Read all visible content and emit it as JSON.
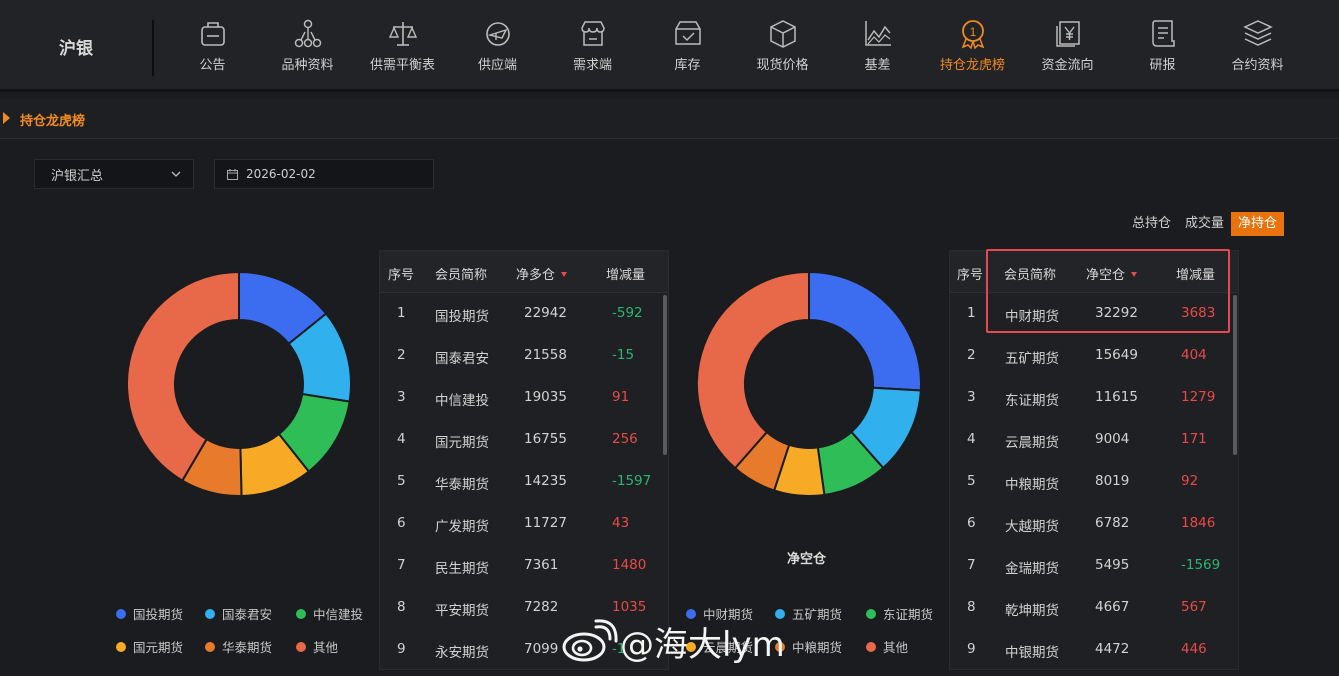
{
  "brand": "沪银",
  "nav": [
    {
      "label": "公告",
      "icon": "announcement-icon",
      "active": false
    },
    {
      "label": "品种资料",
      "icon": "network-icon",
      "active": false
    },
    {
      "label": "供需平衡表",
      "icon": "balance-scale-icon",
      "active": false
    },
    {
      "label": "供应端",
      "icon": "supply-plane-icon",
      "active": false
    },
    {
      "label": "需求端",
      "icon": "store-icon",
      "active": false
    },
    {
      "label": "库存",
      "icon": "inventory-box-icon",
      "active": false
    },
    {
      "label": "现货价格",
      "icon": "cube-icon",
      "active": false
    },
    {
      "label": "基差",
      "icon": "line-chart-icon",
      "active": false
    },
    {
      "label": "持仓龙虎榜",
      "icon": "medal-icon",
      "active": true
    },
    {
      "label": "资金流向",
      "icon": "yen-icon",
      "active": false
    },
    {
      "label": "研报",
      "icon": "report-icon",
      "active": false
    },
    {
      "label": "合约资料",
      "icon": "layers-icon",
      "active": false
    }
  ],
  "section_title": "持仓龙虎榜",
  "filters": {
    "contract": "沪银汇总",
    "date": "2026-02-02"
  },
  "toggle": [
    {
      "label": "总持仓",
      "active": false
    },
    {
      "label": "成交量",
      "active": false
    },
    {
      "label": "净持仓",
      "active": true
    }
  ],
  "colors": {
    "accent": "#f08b21",
    "positive": "#e84a4a",
    "negative": "#2bb573",
    "highlight": "#e8484f"
  },
  "long_table": {
    "headers": [
      "序号",
      "会员简称",
      "净多仓",
      "增减量"
    ],
    "rows": [
      {
        "rank": "1",
        "member": "国投期货",
        "value": "22942",
        "change": "-592"
      },
      {
        "rank": "2",
        "member": "国泰君安",
        "value": "21558",
        "change": "-15"
      },
      {
        "rank": "3",
        "member": "中信建投",
        "value": "19035",
        "change": "91"
      },
      {
        "rank": "4",
        "member": "国元期货",
        "value": "16755",
        "change": "256"
      },
      {
        "rank": "5",
        "member": "华泰期货",
        "value": "14235",
        "change": "-1597"
      },
      {
        "rank": "6",
        "member": "广发期货",
        "value": "11727",
        "change": "43"
      },
      {
        "rank": "7",
        "member": "民生期货",
        "value": "7361",
        "change": "1480"
      },
      {
        "rank": "8",
        "member": "平安期货",
        "value": "7282",
        "change": "1035"
      },
      {
        "rank": "9",
        "member": "永安期货",
        "value": "7099",
        "change": "-1"
      }
    ]
  },
  "short_table": {
    "headers": [
      "序号",
      "会员简称",
      "净空仓",
      "增减量"
    ],
    "rows": [
      {
        "rank": "1",
        "member": "中财期货",
        "value": "32292",
        "change": "3683"
      },
      {
        "rank": "2",
        "member": "五矿期货",
        "value": "15649",
        "change": "404"
      },
      {
        "rank": "3",
        "member": "东证期货",
        "value": "11615",
        "change": "1279"
      },
      {
        "rank": "4",
        "member": "云晨期货",
        "value": "9004",
        "change": "171"
      },
      {
        "rank": "5",
        "member": "中粮期货",
        "value": "8019",
        "change": "92"
      },
      {
        "rank": "6",
        "member": "大越期货",
        "value": "6782",
        "change": "1846"
      },
      {
        "rank": "7",
        "member": "金瑞期货",
        "value": "5495",
        "change": "-1569"
      },
      {
        "rank": "8",
        "member": "乾坤期货",
        "value": "4667",
        "change": "567"
      },
      {
        "rank": "9",
        "member": "中银期货",
        "value": "4472",
        "change": "446"
      }
    ]
  },
  "chart_data": [
    {
      "type": "pie",
      "title": "",
      "categories": [
        "国投期货",
        "国泰君安",
        "中信建投",
        "国元期货",
        "华泰期货",
        "其他"
      ],
      "values": [
        22942,
        21558,
        19035,
        16755,
        14235,
        67200
      ],
      "colors": [
        "#3c6cf0",
        "#31b0ee",
        "#2ebd57",
        "#f6aa26",
        "#e77b2b",
        "#e8684a"
      ],
      "legend_position": "bottom"
    },
    {
      "type": "pie",
      "title": "净空仓",
      "categories": [
        "中财期货",
        "五矿期货",
        "东证期货",
        "云晨期货",
        "中粮期货",
        "其他"
      ],
      "values": [
        32292,
        15649,
        11615,
        9004,
        8019,
        48000
      ],
      "colors": [
        "#3c6cf0",
        "#31b0ee",
        "#2ebd57",
        "#f6aa26",
        "#e77b2b",
        "#e8684a"
      ],
      "legend_position": "bottom"
    }
  ],
  "watermark": "@海大lym"
}
